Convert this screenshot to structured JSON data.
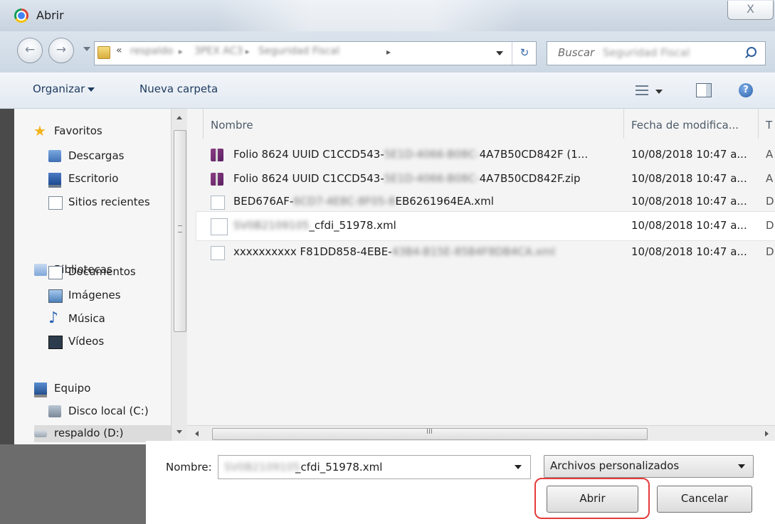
{
  "window": {
    "title": "Abrir",
    "close_glyph": "X",
    "app_icon": "chrome-icon"
  },
  "address": {
    "overflow": "«",
    "crumbs": [
      "respaldo",
      "3PEX AC3",
      "Seguridad Fiscal"
    ],
    "crumb_separator": "▸",
    "end_arrow": "▸",
    "refresh_glyph": "↻"
  },
  "search": {
    "placeholder": "Buscar",
    "blurred_text": "Seguridad Fiscal"
  },
  "toolbar": {
    "organize_label": "Organizar",
    "new_folder_label": "Nueva carpeta",
    "help_glyph": "?"
  },
  "nav": {
    "favorites": "Favoritos",
    "downloads": "Descargas",
    "desktop": "Escritorio",
    "recent": "Sitios recientes",
    "libraries": "Bibliotecas",
    "documents": "Documentos",
    "images": "Imágenes",
    "music": "Música",
    "videos": "Vídeos",
    "computer": "Equipo",
    "local_disk": "Disco local (C:)",
    "backup": "respaldo (D:)"
  },
  "columns": {
    "name": "Nombre",
    "date": "Fecha de modifica...",
    "type": "T"
  },
  "files": [
    {
      "name_pre": "Folio 8624 UUID C1CCD543-",
      "name_blur": "5E1D-4066-B08C-",
      "name_post": "4A7B50CD842F (1...",
      "date": "10/08/2018 10:47 a...",
      "type": "A",
      "icon": "zip-icon"
    },
    {
      "name_pre": "Folio 8624 UUID C1CCD543-",
      "name_blur": "5E1D-4066-B08C-",
      "name_post": "4A7B50CD842F.zip",
      "date": "10/08/2018 10:47 a...",
      "type": "A",
      "icon": "zip-icon"
    },
    {
      "name_pre": "BED676AF-",
      "name_blur": "6CD7-4E8C-8F05-8",
      "name_post": "EB6261964EA.xml",
      "date": "10/08/2018 10:47 a...",
      "type": "D",
      "icon": "xml-file-icon"
    },
    {
      "name_pre": "",
      "name_blur": "SV0B2109105",
      "name_post": "_cfdi_51978.xml",
      "date": "10/08/2018 10:47 a...",
      "type": "D",
      "icon": "xml-file-icon"
    },
    {
      "name_pre": "xxxxxxxxxx F81DD858-4EBE-",
      "name_blur": "43B4-B15E-85B4F8DB4CA.xml",
      "name_post": "",
      "date": "10/08/2018 10:47 a...",
      "type": "D",
      "icon": "xml-file-icon"
    }
  ],
  "scrollbar": {
    "grip": "III"
  },
  "bottom": {
    "filename_label": "Nombre:",
    "filename_blur": "SV0B2109105",
    "filename_value": "_cfdi_51978.xml",
    "filetype_value": "Archivos personalizados",
    "open_label": "Abrir",
    "cancel_label": "Cancelar"
  },
  "colors": {
    "highlight_border": "#e63b3b",
    "link_text": "#1e3a5f"
  }
}
